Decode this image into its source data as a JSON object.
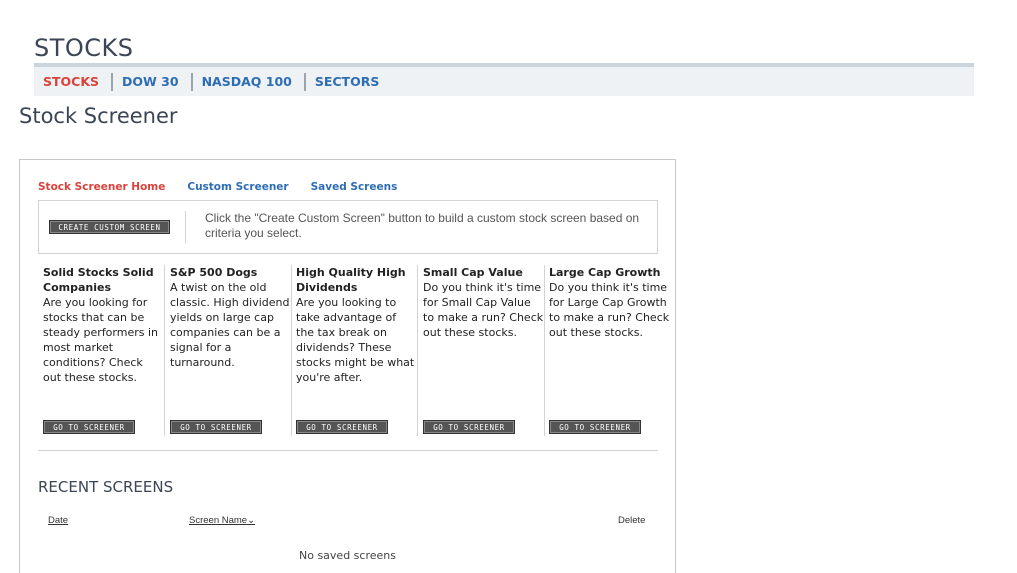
{
  "header": {
    "section_title": "STOCKS",
    "subnav": [
      "STOCKS",
      "DOW 30",
      "NASDAQ 100",
      "SECTORS"
    ],
    "active_subnav": "STOCKS"
  },
  "page_title": "Stock Screener",
  "screener": {
    "tabs": [
      "Stock Screener Home",
      "Custom Screener",
      "Saved Screens"
    ],
    "active_tab": "Stock Screener Home",
    "create_button": "CREATE CUSTOM SCREEN",
    "create_description": "Click the \"Create Custom Screen\" button to build a custom stock screen based on criteria you select.",
    "screens": [
      {
        "name": "Solid Stocks Solid Companies",
        "description": "Are you looking for stocks that can be steady performers in most market conditions? Check out these stocks.",
        "button": "GO TO SCREENER"
      },
      {
        "name": "S&P 500 Dogs",
        "description": "A twist on the old classic. High dividend yields on large cap companies can be a signal for a turnaround.",
        "button": "GO TO SCREENER"
      },
      {
        "name": "High Quality High Dividends",
        "description": "Are you looking to take advantage of the tax break on dividends? These stocks might be what you're after.",
        "button": "GO TO SCREENER"
      },
      {
        "name": "Small Cap Value",
        "description": "Do you think it's time for Small Cap Value to make a run? Check out these stocks.",
        "button": "GO TO SCREENER"
      },
      {
        "name": "Large Cap Growth",
        "description": "Do you think it's time for Large Cap Growth to make a run? Check out these stocks.",
        "button": "GO TO SCREENER"
      }
    ]
  },
  "recent": {
    "title": "RECENT SCREENS",
    "columns": {
      "date": "Date",
      "screen_name": "Screen Name",
      "delete": "Delete"
    },
    "sort_indicator": "⌄",
    "empty_message": "No saved screens"
  },
  "colors": {
    "active_red": "#d9423b",
    "link_blue": "#2d6db5",
    "heading_slate": "#3b4556",
    "button_gray": "#555555"
  }
}
